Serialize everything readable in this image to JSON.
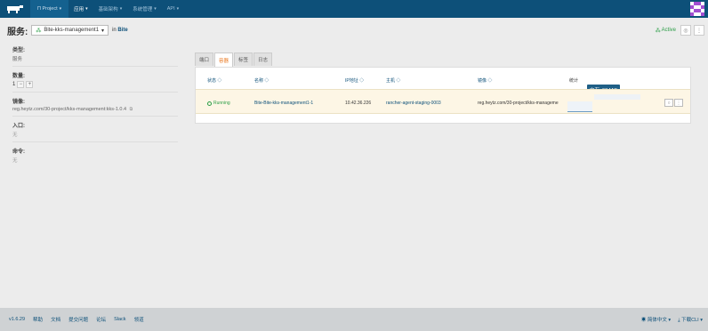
{
  "topnav": {
    "project": "Π Project",
    "items": [
      "应用",
      "基础架构",
      "系统管理"
    ],
    "api": "API",
    "colors": {
      "bar": "#0d5079",
      "avatar": "#6b2a8f"
    }
  },
  "header": {
    "title": "服务:",
    "service_name": "Bite-kks-management1",
    "in_label": "in",
    "stack": "Bite",
    "status": "Active"
  },
  "details": {
    "type_label": "类型:",
    "type_value": "服务",
    "scale_label": "数量:",
    "scale_value": "1",
    "image_label": "镜像:",
    "image_value": "reg.heytz.com/30-project/kks-management:kks-1.0.4",
    "entry_label": "入口:",
    "entry_value": "无",
    "command_label": "命令:",
    "command_value": "无"
  },
  "tabs": [
    "端口",
    "容器",
    "标签",
    "日志"
  ],
  "active_tab": "容器",
  "table": {
    "headers": [
      "状态 ◇",
      "名称 ◇",
      "IP地址 ◇",
      "主机 ◇",
      "镜像 ◇",
      "统计"
    ],
    "row": {
      "state": "Running",
      "name": "Bite-Bite-kks-management1-1",
      "ip": "10.42.36.226",
      "host": "rancher-agent-staging-0003",
      "image": "reg.heytz.com/30-project/kks-manageme"
    },
    "tooltip": "内存: 93 MiB"
  },
  "footer": {
    "version": "v1.6.29",
    "links": [
      "帮助",
      "文档",
      "提交问题",
      "论坛",
      "Slack",
      "领道"
    ],
    "language": "简体中文",
    "download": "下载CLI"
  }
}
